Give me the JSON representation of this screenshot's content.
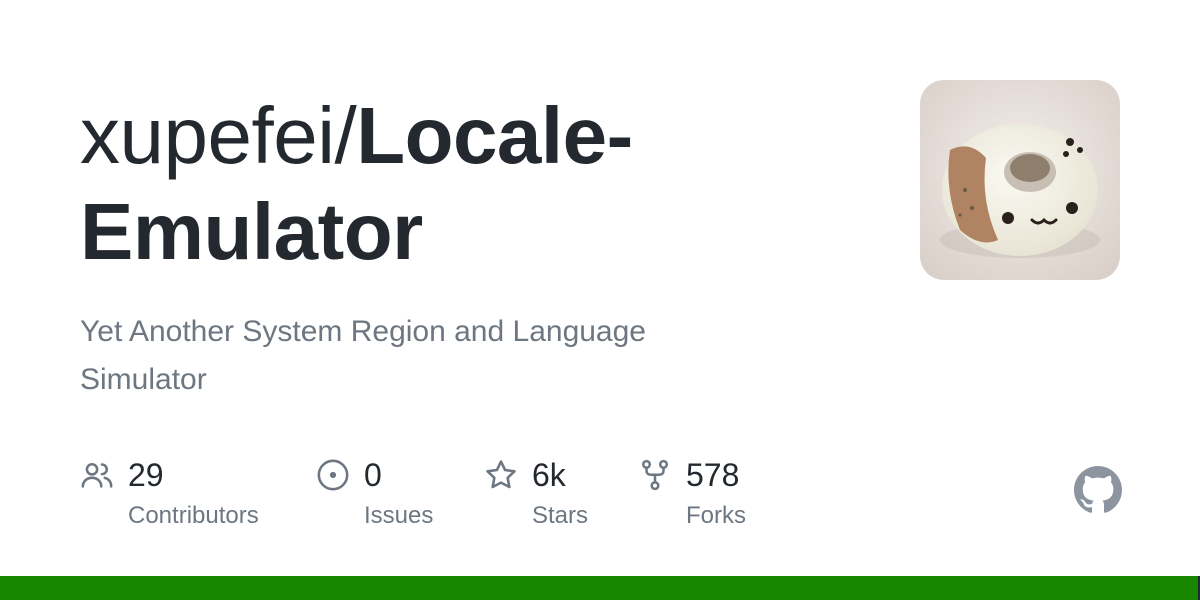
{
  "repo": {
    "owner": "xupefei/",
    "name": "Locale-Emulator",
    "description": "Yet Another System Region and Language Simulator"
  },
  "avatar": {
    "icon": "cat-donut-avatar"
  },
  "stats": [
    {
      "icon": "people-icon",
      "value": "29",
      "label": "Contributors"
    },
    {
      "icon": "issue-opened-icon",
      "value": "0",
      "label": "Issues"
    },
    {
      "icon": "star-icon",
      "value": "6k",
      "label": "Stars"
    },
    {
      "icon": "repo-forked-icon",
      "value": "578",
      "label": "Forks"
    }
  ],
  "languages": [
    {
      "color": "#178600",
      "share": 0.998
    },
    {
      "color": "#24292f",
      "share": 0.002
    }
  ],
  "colors": {
    "title": "#24292f",
    "muted": "#6e7781",
    "icon": "#6e7781",
    "github_logo": "#8c959f"
  }
}
